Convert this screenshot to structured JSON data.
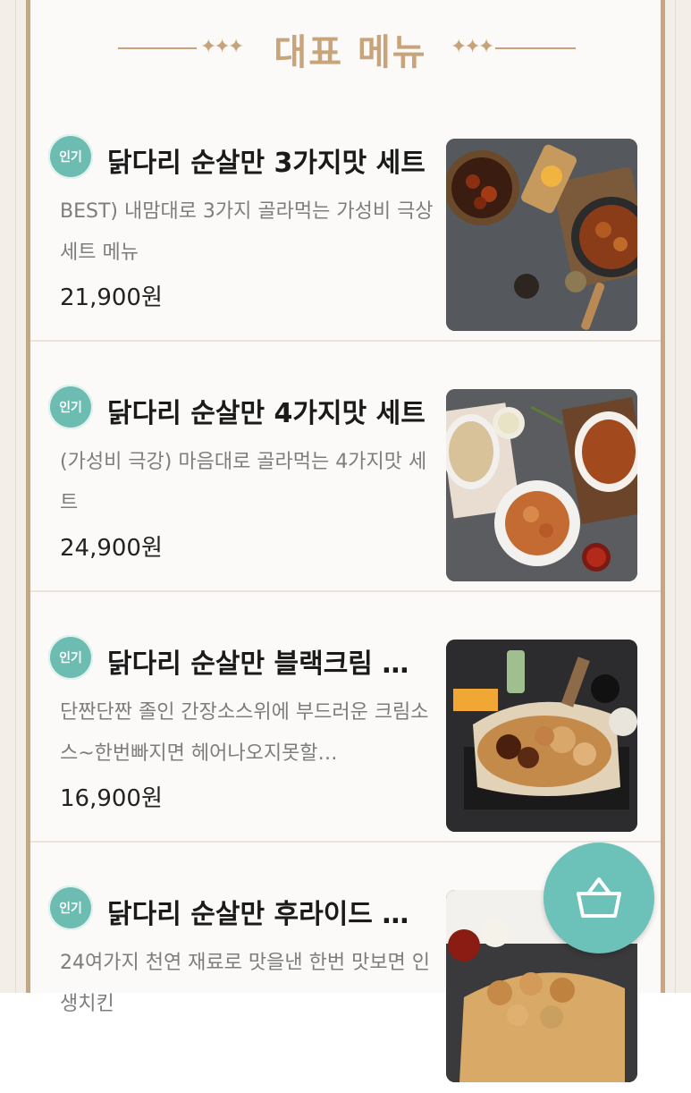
{
  "section_title": "대표 메뉴",
  "menu_items": [
    {
      "badge": "인기",
      "name": "닭다리 순살만 3가지맛 세트",
      "description": "BEST) 내맘대로 3가지 골라먹는 가성비 극상 세트 메뉴",
      "price": "21,900원",
      "photo_icon": "chicken-3-flavors-photo"
    },
    {
      "badge": "인기",
      "name": "닭다리 순살만 4가지맛 세트",
      "description": "(가성비 극강) 마음대로 골라먹는 4가지맛 세트",
      "price": "24,900원",
      "photo_icon": "chicken-4-flavors-photo"
    },
    {
      "badge": "인기",
      "name": "닭다리 순살만 블랙크림 반/…",
      "description": "단짠단짠 졸인 간장소스위에 부드러운 크림소스~한번빠지면 헤어나오지못할…",
      "price": "16,900원",
      "photo_icon": "black-cream-chicken-photo"
    },
    {
      "badge": "인기",
      "name": "닭다리 순살만 후라이드 치킨",
      "description": "24여가지 천연 재료로 맛을낸 한번 맛보면 인생치킨",
      "price": "",
      "photo_icon": "fried-chicken-photo"
    }
  ],
  "cart_button": {
    "icon": "basket-icon"
  },
  "colors": {
    "accent_teal": "#6cbcb1",
    "gold": "#c8a47b"
  }
}
